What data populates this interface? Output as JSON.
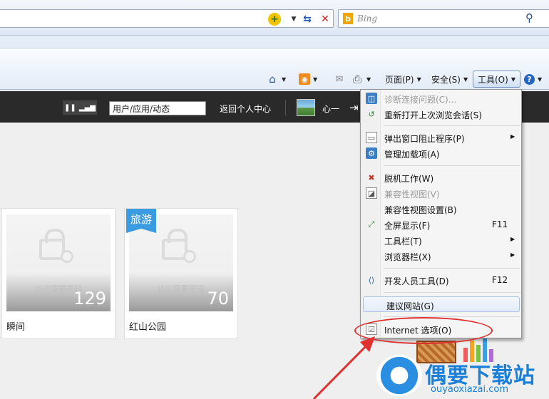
{
  "search": {
    "placeholder": "Bing"
  },
  "command_bar": {
    "page": "页面(P)",
    "safety": "安全(S)",
    "tools": "工具(O)"
  },
  "site": {
    "search_value": "用户/应用/动态",
    "return_link": "返回个人中心",
    "username": "心一"
  },
  "cards": [
    {
      "title": "瞬间",
      "password_text": "访问需要密码",
      "count": "129",
      "tag": ""
    },
    {
      "title": "红山公园",
      "password_text": "访问需要密码",
      "count": "70",
      "tag": "旅游"
    }
  ],
  "tools_menu": {
    "items": [
      {
        "label": "诊断连接问题(C)...",
        "shortcut": "",
        "disabled": true,
        "submenu": false,
        "icon": "diagnose-icon"
      },
      {
        "label": "重新打开上次浏览会话(S)",
        "shortcut": "",
        "disabled": false,
        "submenu": false,
        "icon": "reopen-icon"
      },
      {
        "label": "弹出窗口阻止程序(P)",
        "shortcut": "",
        "disabled": false,
        "submenu": true,
        "icon": "popup-blocker-icon"
      },
      {
        "label": "管理加载项(A)",
        "shortcut": "",
        "disabled": false,
        "submenu": false,
        "icon": "addons-icon"
      },
      {
        "label": "脱机工作(W)",
        "shortcut": "",
        "disabled": false,
        "submenu": false,
        "icon": "offline-icon"
      },
      {
        "label": "兼容性视图(V)",
        "shortcut": "",
        "disabled": true,
        "submenu": false,
        "icon": "compat-view-icon"
      },
      {
        "label": "兼容性视图设置(B)",
        "shortcut": "",
        "disabled": false,
        "submenu": false,
        "icon": ""
      },
      {
        "label": "全屏显示(F)",
        "shortcut": "F11",
        "disabled": false,
        "submenu": false,
        "icon": "fullscreen-icon"
      },
      {
        "label": "工具栏(T)",
        "shortcut": "",
        "disabled": false,
        "submenu": true,
        "icon": ""
      },
      {
        "label": "浏览器栏(X)",
        "shortcut": "",
        "disabled": false,
        "submenu": true,
        "icon": ""
      },
      {
        "label": "开发人员工具(D)",
        "shortcut": "F12",
        "disabled": false,
        "submenu": false,
        "icon": "dev-tools-icon"
      },
      {
        "label": "建议网站(G)",
        "shortcut": "",
        "disabled": false,
        "submenu": false,
        "icon": "",
        "highlighted": true
      },
      {
        "label": "Internet 选项(O)",
        "shortcut": "",
        "disabled": false,
        "submenu": false,
        "icon": "internet-options-icon"
      }
    ]
  },
  "watermark": {
    "title": "偶要下载站",
    "url": "ouyaoxiazai.com"
  },
  "colors": {
    "annotation": "#e03030",
    "highlight_border": "#a9c2e4",
    "site_header": "#2a2a2a"
  }
}
